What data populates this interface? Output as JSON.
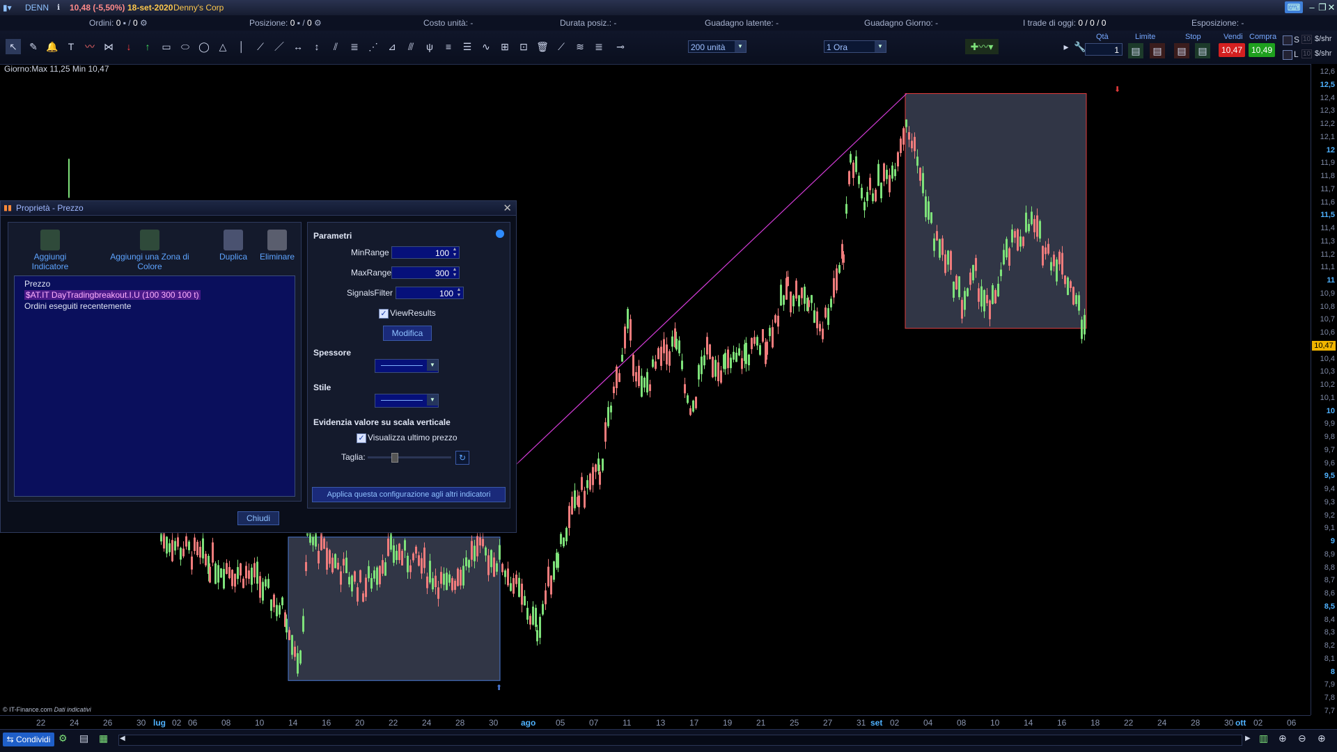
{
  "titlebar": {
    "symbol": "DENN",
    "price_change": "10,48 (-5,50%)",
    "date": "18-set-2020",
    "company": "Denny's Corp"
  },
  "infobar": {
    "orders_label": "Ordini:",
    "orders_value": "0",
    "orders_value2": "0",
    "position_label": "Posizione:",
    "position_value": "0",
    "position_value2": "0",
    "unit_cost": "Costo unità: -",
    "duration": "Durata posiz.: -",
    "latent_gain": "Guadagno latente: -",
    "day_gain": "Guadagno Giorno: -",
    "trades_label": "I trade di oggi:",
    "trades_value": "0 / 0 / 0",
    "exposure": "Esposizione: -"
  },
  "toolbar": {
    "units_combo": "200 unità",
    "timeframe_combo": "1 Ora",
    "qty_label": "Qtà",
    "qty_value": "1",
    "limit_label": "Limite",
    "stop_label": "Stop",
    "sell_label": "Vendi",
    "buy_label": "Compra",
    "sell_price": "10,47",
    "buy_price": "10,49",
    "s_label": "S",
    "l_label": "L",
    "s_value": "10",
    "l_value": "10",
    "s_unit": "$/shr",
    "l_unit": "$/shr"
  },
  "chart": {
    "day_info": "Giorno:Max 11,25 Min 10,47",
    "copyright": "© IT-Finance.com",
    "copyright_note": "Dati indicativi",
    "last_price": "10,47",
    "colors": {
      "up": "#7ee27a",
      "down": "#f07c7c",
      "trendline": "#d43cd8",
      "zone_fill": "#3a4052",
      "zone_border_top": "#e23b3b",
      "zone_border_bottom": "#4a7ad6"
    }
  },
  "yaxis": [
    "12,6",
    "12,5",
    "12,4",
    "12,3",
    "12,2",
    "12,1",
    "12",
    "11,9",
    "11,8",
    "11,7",
    "11,6",
    "11,5",
    "11,4",
    "11,3",
    "11,2",
    "11,1",
    "11",
    "10,9",
    "10,8",
    "10,7",
    "10,6",
    "10,5",
    "10,4",
    "10,3",
    "10,2",
    "10,1",
    "10",
    "9,9",
    "9,8",
    "9,7",
    "9,6",
    "9,5",
    "9,4",
    "9,3",
    "9,2",
    "9,1",
    "9",
    "8,9",
    "8,8",
    "8,7",
    "8,6",
    "8,5",
    "8,4",
    "8,3",
    "8,2",
    "8,1",
    "8",
    "7,9",
    "7,8",
    "7,7"
  ],
  "xaxis": [
    "22",
    "24",
    "26",
    "30",
    "lug",
    "02",
    "06",
    "08",
    "10",
    "14",
    "16",
    "20",
    "22",
    "24",
    "28",
    "30",
    "ago",
    "05",
    "07",
    "11",
    "13",
    "17",
    "19",
    "21",
    "25",
    "27",
    "31",
    "set",
    "02",
    "04",
    "08",
    "10",
    "14",
    "16",
    "18",
    "22",
    "24",
    "28",
    "30",
    "ott",
    "02",
    "06"
  ],
  "dialog": {
    "title": "Proprietà - Prezzo",
    "btn_add_indicator": "Aggiungi Indicatore",
    "btn_add_zone": "Aggiungi una Zona di Colore",
    "btn_duplicate": "Duplica",
    "btn_delete": "Eliminare",
    "tree": [
      "Prezzo",
      "$AT.IT DayTradingbreakout.I.U (100 300 100 t)",
      "Ordini eseguiti recentemente"
    ],
    "close": "Chiudi",
    "params_title": "Parametri",
    "minrange_label": "MinRange",
    "minrange_value": "100",
    "maxrange_label": "MaxRange",
    "maxrange_value": "300",
    "signals_label": "SignalsFilter",
    "signals_value": "100",
    "viewresults": "ViewResults",
    "modify": "Modifica",
    "thickness": "Spessore",
    "style": "Stile",
    "highlight_title": "Evidenzia valore su scala verticale",
    "show_last": "Visualizza ultimo prezzo",
    "size_label": "Taglia:",
    "size_level": 0.3,
    "apply_all": "Applica questa configurazione agli altri indicatori"
  },
  "bottombar": {
    "share": "Condividi"
  }
}
